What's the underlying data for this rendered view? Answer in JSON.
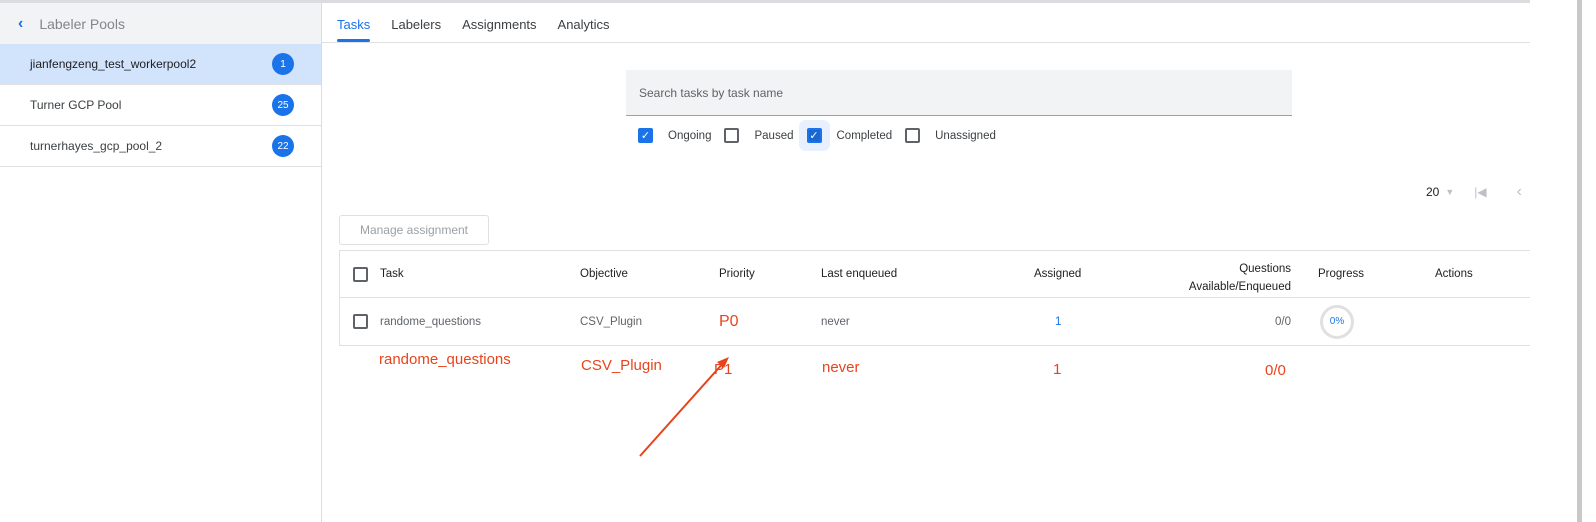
{
  "sidebar": {
    "title": "Labeler Pools",
    "pools": [
      {
        "name": "jianfengzeng_test_workerpool2",
        "count": "1",
        "selected": true
      },
      {
        "name": "Turner GCP Pool",
        "count": "25"
      },
      {
        "name": "turnerhayes_gcp_pool_2",
        "count": "22"
      }
    ]
  },
  "tabs": [
    "Tasks",
    "Labelers",
    "Assignments",
    "Analytics"
  ],
  "active_tab": "Tasks",
  "search": {
    "placeholder": "Search tasks by task name"
  },
  "filters": [
    {
      "label": "Ongoing",
      "checked": true
    },
    {
      "label": "Paused",
      "checked": false
    },
    {
      "label": "Completed",
      "checked": true
    },
    {
      "label": "Unassigned",
      "checked": false
    }
  ],
  "pager": {
    "page_size": "20"
  },
  "manage_button": "Manage assignment",
  "table": {
    "headers": {
      "task": "Task",
      "objective": "Objective",
      "priority": "Priority",
      "last": "Last enqueued",
      "assigned": "Assigned",
      "questions1": "Questions",
      "questions2": "Available/Enqueued",
      "progress": "Progress",
      "actions": "Actions"
    },
    "rows": [
      {
        "task": "randome_questions",
        "objective": "CSV_Plugin",
        "priority": "P0",
        "last": "never",
        "assigned": "1",
        "questions": "0/0",
        "progress": "0%"
      }
    ]
  },
  "annotation": {
    "task": "randome_questions",
    "objective": "CSV_Plugin",
    "priority": "P1",
    "last": "never",
    "assigned": "1",
    "questions": "0/0",
    "color": "#e8441c"
  }
}
